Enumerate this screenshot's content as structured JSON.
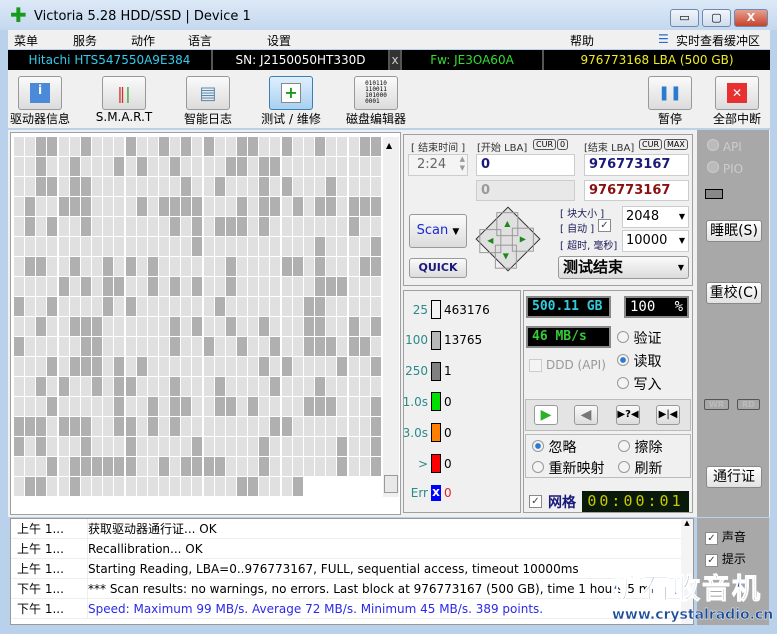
{
  "window": {
    "title": "Victoria 5.28 HDD/SSD | Device 1",
    "minimize": "▭",
    "maximize": "▢",
    "close": "X"
  },
  "menu": [
    "菜单",
    "服务",
    "动作",
    "语言",
    "设置",
    "帮助"
  ],
  "menu_buffer": "实时查看缓冲区",
  "info": {
    "model": "Hitachi HTS547550A9E384",
    "serial": "SN: J2150050HT330D",
    "close": "x",
    "firmware": "Fw: JE3OA60A",
    "capacity": "976773168 LBA (500 GB)"
  },
  "toolbar": [
    {
      "label": "驱动器信息",
      "icon": "info-icon"
    },
    {
      "label": "S.M.A.R.T",
      "icon": "test-tubes-icon"
    },
    {
      "label": "智能日志",
      "icon": "log-folder-icon"
    },
    {
      "label": "测试 / 维修",
      "icon": "first-aid-icon"
    },
    {
      "label": "磁盘编辑器",
      "icon": "binary-icon",
      "glyph": "010110\n110011\n101000\n0001"
    }
  ],
  "toolbar_right": [
    {
      "label": "暂停",
      "icon": "pause-icon"
    },
    {
      "label": "全部中断",
      "icon": "stop-icon"
    }
  ],
  "scan": {
    "end_time_label": "[ 结束时间 ]",
    "end_time": "2:24",
    "start_lba_label": "[开始 LBA]",
    "cur": "CUR",
    "zero": "0",
    "end_lba_label": "[结束 LBA]",
    "max": "MAX",
    "start_lba": "0",
    "end_lba": "976773167",
    "cur_lba": "0",
    "cur_end_lba": "976773167",
    "block_size_label": "[ 块大小 ]",
    "auto_label": "[ 自动 ]",
    "auto_checked": true,
    "block_size": "2048",
    "timeout_label": "[ 超时, 毫秒]",
    "timeout": "10000",
    "scan_button": "Scan",
    "quick_button": "QUICK",
    "status_select": "测试结束"
  },
  "legend": [
    {
      "label": "25",
      "count": "463176",
      "color": "#f4f4f4"
    },
    {
      "label": "100",
      "count": "13765",
      "color": "#b8b8b8"
    },
    {
      "label": "250",
      "count": "1",
      "color": "#808080"
    },
    {
      "label": "1.0s",
      "count": "0",
      "color": "#00e000"
    },
    {
      "label": "3.0s",
      "count": "0",
      "color": "#ff8000"
    },
    {
      "label": ">",
      "count": "0",
      "color": "#ff0000"
    },
    {
      "label": "Err",
      "count": "0",
      "color": "#0000ff",
      "glyph": "x"
    }
  ],
  "stats": {
    "size": "500.11 GB",
    "percent": "100",
    "percent_sign": "%",
    "speed": "46 MB/s",
    "ddd": "DDD (API)",
    "ddd_checked": false
  },
  "mode": {
    "options": [
      "验证",
      "读取",
      "写入"
    ],
    "selected": "读取"
  },
  "action": {
    "options": [
      "忽略",
      "擦除",
      "重新映射",
      "刷新"
    ],
    "selected": "忽略"
  },
  "grid_label": "网格",
  "grid_checked": true,
  "timer": "00:00:01",
  "side": {
    "api": "API",
    "pio": "PIO",
    "sleep": "睡眠(S)",
    "recal": "重校(C)",
    "wr": "WR",
    "rd": "RD",
    "passport": "通行证",
    "sound": "声音",
    "sound_checked": true,
    "hints": "提示",
    "hints_checked": true
  },
  "log": [
    {
      "time": "上午 1...",
      "msg": "获取驱动器通行证... OK"
    },
    {
      "time": "上午 1...",
      "msg": "Recallibration... OK"
    },
    {
      "time": "上午 1...",
      "msg": "Starting Reading, LBA=0..976773167, FULL, sequential access, timeout 10000ms"
    },
    {
      "time": "下午 1...",
      "msg": "*** Scan results: no warnings, no errors. Last block at 976773167 (500 GB), time 1 hours 5 mi"
    },
    {
      "time": "下午 1...",
      "msg": "Speed: Maximum 99 MB/s. Average 72 MB/s. Minimum 45 MB/s. 389 points."
    }
  ],
  "watermark": {
    "cn": "矿石收音机",
    "url": "www.crystalradio.cn"
  },
  "colors": {
    "grid_light": "#e0e0e0",
    "grid_dark": "#b0b0b0",
    "lcd_cyan": "#33ccdd",
    "lcd_green": "#33cc33",
    "log_blue": "#2a2ae8"
  }
}
